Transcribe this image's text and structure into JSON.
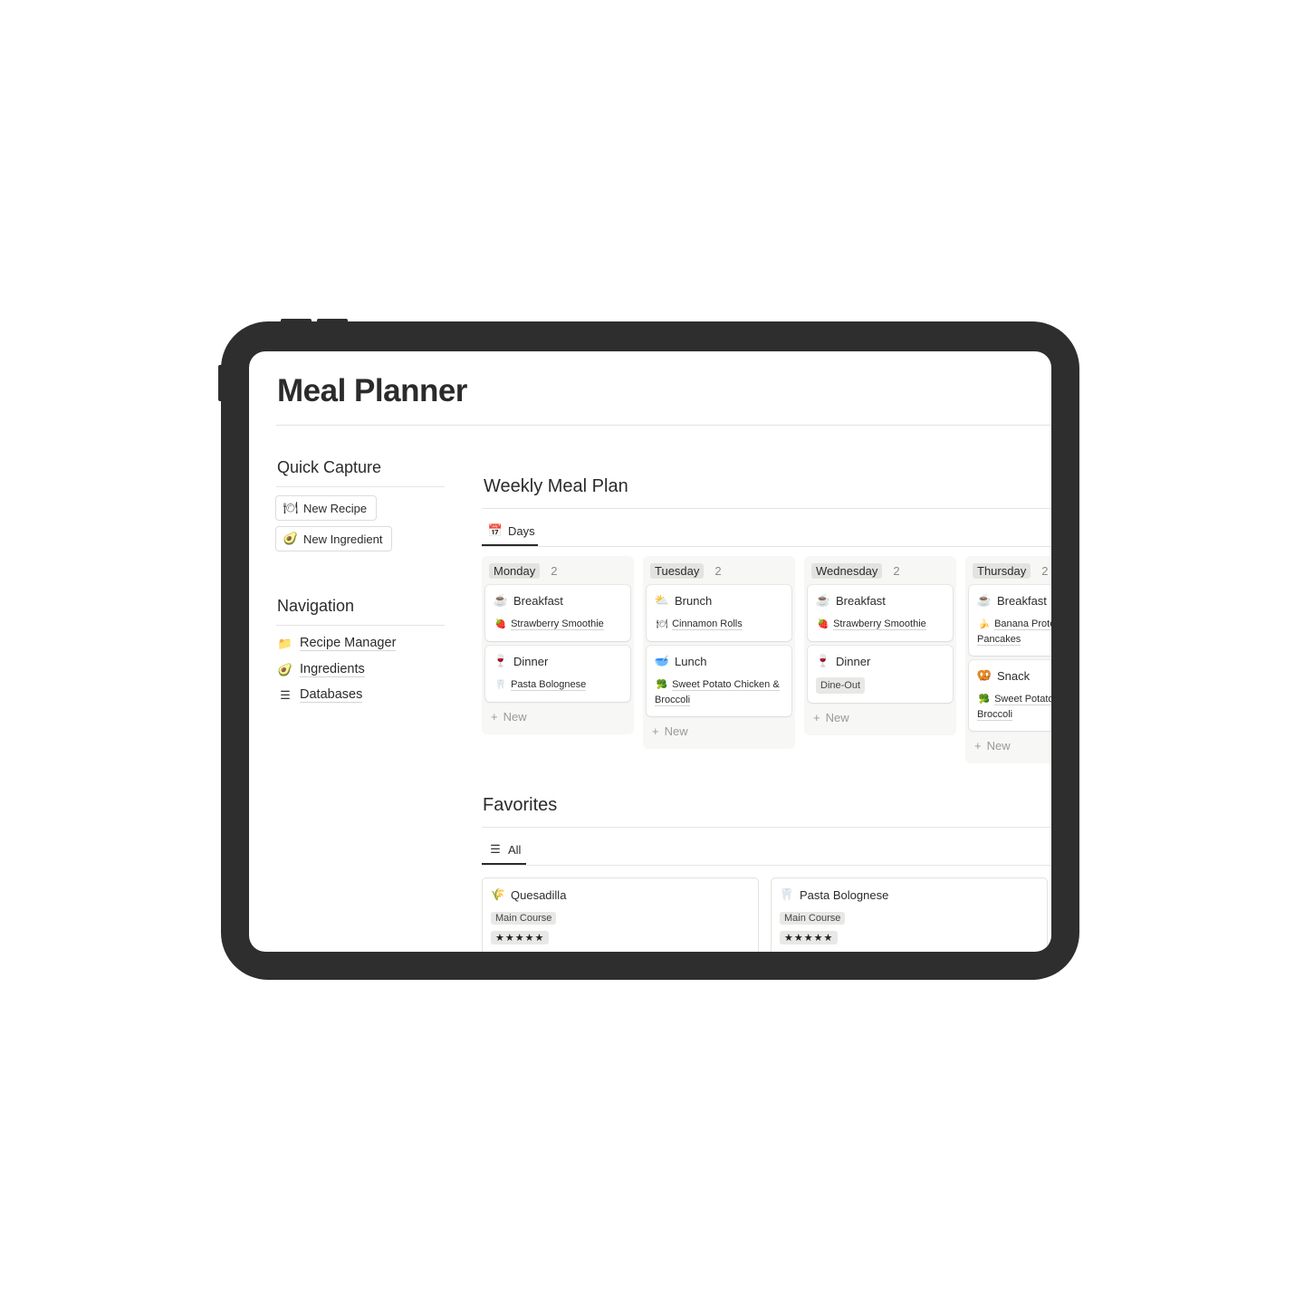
{
  "page": {
    "title": "Meal Planner"
  },
  "quick_capture": {
    "heading": "Quick Capture",
    "buttons": [
      {
        "label": "New Recipe",
        "icon": "fork-plate-icon"
      },
      {
        "label": "New Ingredient",
        "icon": "avocado-icon"
      }
    ]
  },
  "navigation": {
    "heading": "Navigation",
    "items": [
      {
        "label": "Recipe Manager",
        "icon": "folder-icon"
      },
      {
        "label": "Ingredients",
        "icon": "avocado-icon"
      },
      {
        "label": "Databases",
        "icon": "database-icon"
      }
    ]
  },
  "weekly": {
    "heading": "Weekly Meal Plan",
    "tab": "Days",
    "new_label": "New",
    "columns": [
      {
        "day": "Monday",
        "count": "2",
        "cards": [
          {
            "meal": "Breakfast",
            "icon": "coffee-icon",
            "item": "Strawberry Smoothie",
            "item_icon": "strawberry-icon"
          },
          {
            "meal": "Dinner",
            "icon": "wine-icon",
            "item": "Pasta Bolognese",
            "item_icon": "tooth-icon"
          }
        ]
      },
      {
        "day": "Tuesday",
        "count": "2",
        "cards": [
          {
            "meal": "Brunch",
            "icon": "sun-cloud-icon",
            "item": "Cinnamon Rolls",
            "item_icon": "fork-plate-icon"
          },
          {
            "meal": "Lunch",
            "icon": "bowl-icon",
            "item": "Sweet Potato Chicken & Broccoli",
            "item_icon": "broccoli-icon"
          }
        ]
      },
      {
        "day": "Wednesday",
        "count": "2",
        "cards": [
          {
            "meal": "Breakfast",
            "icon": "coffee-icon",
            "item": "Strawberry Smoothie",
            "item_icon": "strawberry-icon"
          },
          {
            "meal": "Dinner",
            "icon": "wine-icon",
            "tag": "Dine-Out"
          }
        ]
      },
      {
        "day": "Thursday",
        "count": "2",
        "cards": [
          {
            "meal": "Breakfast",
            "icon": "coffee-icon",
            "item": "Banana Protein Pancakes",
            "item_icon": "banana-icon"
          },
          {
            "meal": "Snack",
            "icon": "pretzel-icon",
            "item": "Sweet Potato Chicken & Broccoli",
            "item_icon": "broccoli-icon"
          }
        ]
      }
    ]
  },
  "favorites": {
    "heading": "Favorites",
    "tab": "All",
    "cards": [
      {
        "title": "Quesadilla",
        "icon": "wheat-icon",
        "category": "Main Course",
        "rating": "★★★★★"
      },
      {
        "title": "Pasta Bolognese",
        "icon": "tooth-icon",
        "category": "Main Course",
        "rating": "★★★★★"
      }
    ]
  }
}
